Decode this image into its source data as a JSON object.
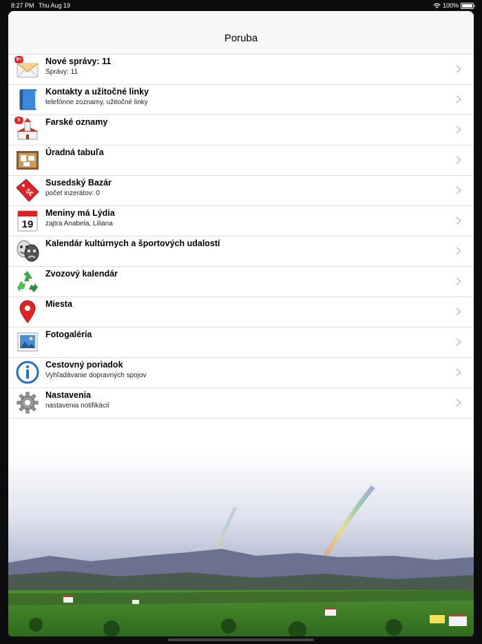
{
  "status": {
    "time": "8:27 PM",
    "date": "Thu Aug 19",
    "battery": "100%"
  },
  "nav": {
    "title": "Poruba"
  },
  "rows": [
    {
      "title": "Nové správy: 11",
      "subtitle": "Správy: 11",
      "icon": "envelope-icon",
      "badge": "9+"
    },
    {
      "title": "Kontakty a užitočné linky",
      "subtitle": "telefónne zoznamy, užitočné linky",
      "icon": "book-icon",
      "badge": ""
    },
    {
      "title": "Farské oznamy",
      "subtitle": "",
      "icon": "church-icon",
      "badge": "5"
    },
    {
      "title": "Úradná tabuľa",
      "subtitle": "",
      "icon": "bulletin-board-icon",
      "badge": ""
    },
    {
      "title": "Susedský Bazár",
      "subtitle": "počet inzerátov: 0",
      "icon": "price-tag-icon",
      "badge": "",
      "tag_text": "5€"
    },
    {
      "title": "Meniny má Lýdia",
      "subtitle": "zajtra Anabela, Liliana",
      "icon": "calendar-icon",
      "badge": "",
      "calendar_day": "19"
    },
    {
      "title": "Kalendár kultúrnych a športových udalostí",
      "subtitle": "",
      "icon": "theater-masks-icon",
      "badge": ""
    },
    {
      "title": "Zvozový kalendár",
      "subtitle": "",
      "icon": "recycle-icon",
      "badge": ""
    },
    {
      "title": "Miesta",
      "subtitle": "",
      "icon": "map-pin-icon",
      "badge": ""
    },
    {
      "title": "Fotogaléria",
      "subtitle": "",
      "icon": "photo-icon",
      "badge": ""
    },
    {
      "title": "Cestovný poriadok",
      "subtitle": "Vyhľadávanie dopravných spojov",
      "icon": "info-icon",
      "badge": ""
    },
    {
      "title": "Nastavenia",
      "subtitle": "nastavenia notifikácií",
      "icon": "gear-icon",
      "badge": ""
    }
  ],
  "colors": {
    "accent_red": "#e22222",
    "separator": "#e0e0e0",
    "nav_background": "#f7f7f7",
    "chevron": "#c4c4c4"
  }
}
